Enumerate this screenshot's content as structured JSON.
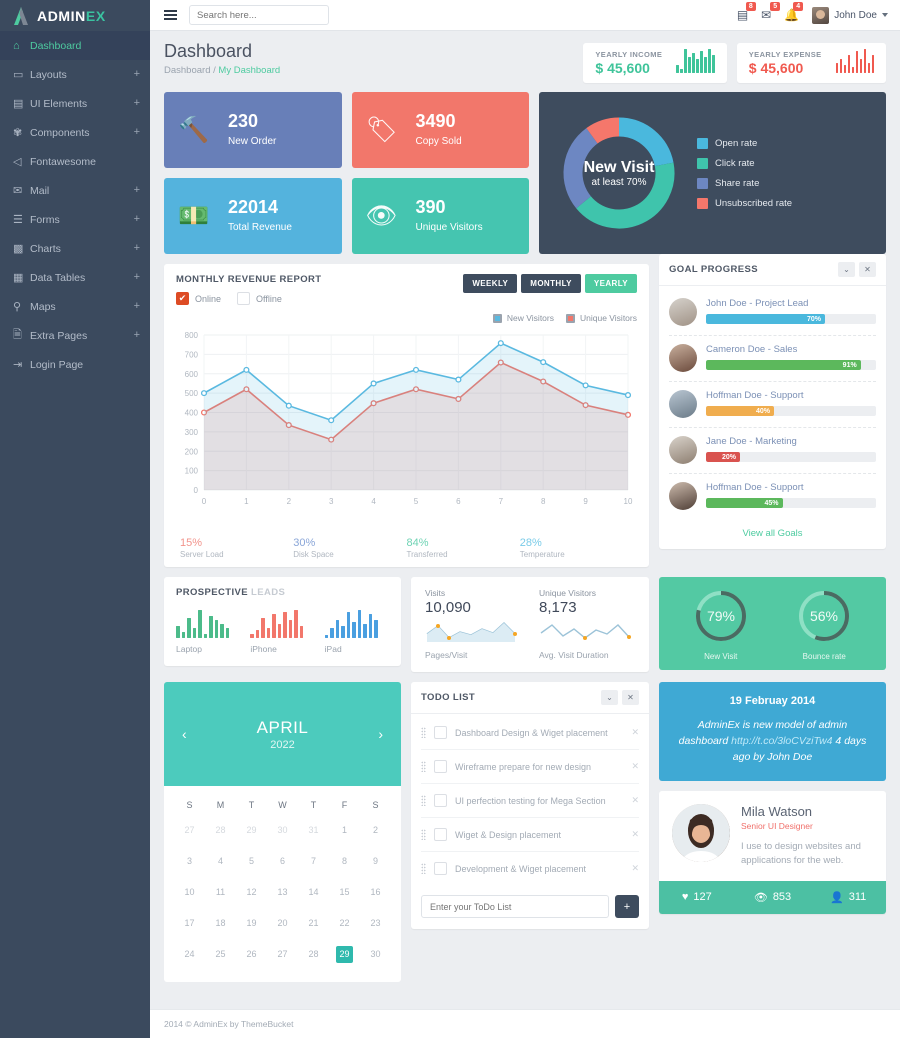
{
  "brand": {
    "name_main": "ADMIN",
    "name_accent": "EX",
    "logo_icon": "triangle-a-logo"
  },
  "sidebar": {
    "items": [
      {
        "label": "Dashboard",
        "icon": "home-icon",
        "expand": "",
        "active": true
      },
      {
        "label": "Layouts",
        "icon": "laptop-icon",
        "expand": "+",
        "active": false
      },
      {
        "label": "UI Elements",
        "icon": "book-icon",
        "expand": "+",
        "active": false
      },
      {
        "label": "Components",
        "icon": "gears-icon",
        "expand": "+",
        "active": false
      },
      {
        "label": "Fontawesome",
        "icon": "megaphone-icon",
        "expand": "",
        "active": false
      },
      {
        "label": "Mail",
        "icon": "envelope-icon",
        "expand": "+",
        "active": false
      },
      {
        "label": "Forms",
        "icon": "form-list-icon",
        "expand": "+",
        "active": false
      },
      {
        "label": "Charts",
        "icon": "bar-chart-icon",
        "expand": "+",
        "active": false
      },
      {
        "label": "Data Tables",
        "icon": "table-grid-icon",
        "expand": "+",
        "active": false
      },
      {
        "label": "Maps",
        "icon": "map-pin-icon",
        "expand": "+",
        "active": false
      },
      {
        "label": "Extra Pages",
        "icon": "file-icon",
        "expand": "+",
        "active": false
      },
      {
        "label": "Login Page",
        "icon": "sign-in-icon",
        "expand": "",
        "active": false
      }
    ]
  },
  "topbar": {
    "menu_toggle_icon": "hamburger-icon",
    "search": {
      "placeholder": "Search here...",
      "value": ""
    },
    "notifications": [
      {
        "icon": "tasks-icon",
        "count": "8"
      },
      {
        "icon": "envelope-icon",
        "count": "5"
      },
      {
        "icon": "bell-icon",
        "count": "4"
      }
    ],
    "user": {
      "name": "John Doe",
      "avatar": "user-avatar",
      "caret_icon": "caret-down-icon"
    }
  },
  "page": {
    "title": "Dashboard",
    "breadcrumb": {
      "root": "Dashboard",
      "sep": "/",
      "current": "My Dashboard"
    }
  },
  "mini_stats": [
    {
      "label": "YEARLY INCOME",
      "value": "$ 45,600",
      "color": "#3fc49a",
      "spark": [
        8,
        4,
        24,
        16,
        20,
        14,
        22,
        16,
        24,
        18
      ]
    },
    {
      "label": "YEARLY EXPENSE",
      "value": "$ 45,600",
      "color": "#f0594f",
      "spark": [
        10,
        14,
        8,
        18,
        6,
        22,
        14,
        24,
        10,
        18
      ]
    }
  ],
  "kpis": [
    {
      "number": "230",
      "caption": "New Order",
      "icon": "gavel-icon",
      "color": "#687fb8"
    },
    {
      "number": "3490",
      "caption": "Copy Sold",
      "icon": "tags-icon",
      "color": "#f2776b"
    },
    {
      "number": "22014",
      "caption": "Total Revenue",
      "icon": "money-icon",
      "color": "#54b3dd"
    },
    {
      "number": "390",
      "caption": "Unique Visitors",
      "icon": "eye-icon",
      "color": "#45c5b0"
    }
  ],
  "donut": {
    "center_title": "New Visit",
    "center_sub": "at least 70%",
    "background": "#3e4c5e",
    "legend": [
      {
        "label": "Open rate",
        "color": "#4ab8dd",
        "value": 22
      },
      {
        "label": "Click rate",
        "color": "#3fc4ac",
        "value": 42
      },
      {
        "label": "Share rate",
        "color": "#6d87c2",
        "value": 26
      },
      {
        "label": "Unsubscribed rate",
        "color": "#f5776b",
        "value": 10
      }
    ]
  },
  "revenue": {
    "title": "MONTHLY REVENUE REPORT",
    "checkboxes": [
      {
        "label": "Online",
        "checked": true
      },
      {
        "label": "Offline",
        "checked": false
      }
    ],
    "range_buttons": [
      {
        "label": "WEEKLY",
        "active": false
      },
      {
        "label": "MONTHLY",
        "active": false
      },
      {
        "label": "YEARLY",
        "active": true
      }
    ],
    "stats": [
      {
        "percent": "15%",
        "caption": "Server Load",
        "color": "#f2948c"
      },
      {
        "percent": "30%",
        "caption": "Disk Space",
        "color": "#8aa6d8"
      },
      {
        "percent": "84%",
        "caption": "Transferred",
        "color": "#6fd3b4"
      },
      {
        "percent": "28%",
        "caption": "Temperature",
        "color": "#79cbe8"
      }
    ]
  },
  "chart_data": {
    "type": "area",
    "title": "MONTHLY REVENUE REPORT",
    "xlabel": "",
    "ylabel": "",
    "x": [
      0,
      1,
      2,
      3,
      4,
      5,
      6,
      7,
      8,
      9,
      10
    ],
    "xticks": [
      "0",
      "1",
      "2",
      "3",
      "4",
      "5",
      "6",
      "7",
      "8",
      "9",
      "10"
    ],
    "yticks": [
      "0",
      "100",
      "200",
      "300",
      "400",
      "500",
      "600",
      "700",
      "800"
    ],
    "xlim": [
      0,
      10
    ],
    "ylim": [
      0,
      800
    ],
    "grid": true,
    "legend_position": "top-right",
    "series": [
      {
        "name": "New Visitors",
        "color": "#5ab9e0",
        "values": [
          500,
          620,
          435,
          360,
          550,
          620,
          570,
          758,
          660,
          540,
          490
        ]
      },
      {
        "name": "Unique Visitors",
        "color": "#f2776b",
        "values": [
          400,
          520,
          335,
          260,
          448,
          520,
          470,
          658,
          560,
          438,
          388
        ]
      }
    ]
  },
  "goal_progress": {
    "title": "GOAL PROGRESS",
    "tools": [
      {
        "icon": "chevron-down-icon"
      },
      {
        "icon": "close-icon"
      }
    ],
    "items": [
      {
        "name": "John Doe - Project Lead",
        "percent": "70%",
        "value": 70,
        "color": "#4ab8dd",
        "avatar": "avatar-john"
      },
      {
        "name": "Cameron Doe - Sales",
        "percent": "91%",
        "value": 91,
        "color": "#5cb85c",
        "avatar": "avatar-cameron"
      },
      {
        "name": "Hoffman Doe - Support",
        "percent": "40%",
        "value": 40,
        "color": "#f0ad4e",
        "avatar": "avatar-hoffman"
      },
      {
        "name": "Jane Doe - Marketing",
        "percent": "20%",
        "value": 20,
        "color": "#d9534f",
        "avatar": "avatar-jane"
      },
      {
        "name": "Hoffman Doe - Support",
        "percent": "45%",
        "value": 45,
        "color": "#5cb85c",
        "avatar": "avatar-hoffman2"
      }
    ],
    "view_all": "View all Goals"
  },
  "prospective": {
    "title_strong": "PROSPECTIVE",
    "title_muted": "LEADS",
    "items": [
      {
        "label": "Laptop",
        "color": "#4cbb8a",
        "bars": [
          12,
          6,
          20,
          10,
          28,
          4,
          22,
          18,
          14,
          10
        ]
      },
      {
        "label": "iPhone",
        "color": "#f2776b",
        "bars": [
          4,
          8,
          20,
          10,
          24,
          14,
          26,
          18,
          28,
          12
        ]
      },
      {
        "label": "iPad",
        "color": "#4a9fe0",
        "bars": [
          3,
          10,
          18,
          12,
          26,
          16,
          28,
          14,
          24,
          18
        ]
      }
    ]
  },
  "visits": {
    "columns": [
      {
        "label": "Visits",
        "value": "10,090",
        "caption": "Pages/Visit"
      },
      {
        "label": "Unique Visitors",
        "value": "8,173",
        "caption": "Avg. Visit Duration"
      }
    ]
  },
  "gauges": {
    "background": "#53c9a3",
    "items": [
      {
        "percent": "79%",
        "value": 79,
        "caption": "New Visit"
      },
      {
        "percent": "56%",
        "value": 56,
        "caption": "Bounce rate"
      }
    ]
  },
  "tweet": {
    "date": "19 Februay 2014",
    "text_before": "AdminEx is new model of admin dashboard ",
    "link": "http://t.co/3loCVziTw4",
    "text_after": " 4 days ago by John Doe",
    "background": "#3fa9d4"
  },
  "profile": {
    "name": "Mila Watson",
    "role": "Senior UI Designer",
    "description": "I use to design websites and applications for the web.",
    "avatar": "avatar-mila",
    "stats": [
      {
        "icon": "heart-icon",
        "value": "127"
      },
      {
        "icon": "eye-icon",
        "value": "853"
      },
      {
        "icon": "user-icon",
        "value": "311"
      }
    ]
  },
  "calendar": {
    "month": "APRIL",
    "year": "2022",
    "prev_icon": "chevron-left-icon",
    "next_icon": "chevron-right-icon",
    "weekdays": [
      "S",
      "M",
      "T",
      "W",
      "T",
      "F",
      "S"
    ],
    "weeks": [
      [
        {
          "d": "27",
          "mut": true
        },
        {
          "d": "28",
          "mut": true
        },
        {
          "d": "29",
          "mut": true
        },
        {
          "d": "30",
          "mut": true
        },
        {
          "d": "31",
          "mut": true
        },
        {
          "d": "1"
        },
        {
          "d": "2"
        }
      ],
      [
        {
          "d": "3"
        },
        {
          "d": "4"
        },
        {
          "d": "5"
        },
        {
          "d": "6"
        },
        {
          "d": "7"
        },
        {
          "d": "8"
        },
        {
          "d": "9"
        }
      ],
      [
        {
          "d": "10"
        },
        {
          "d": "11"
        },
        {
          "d": "12"
        },
        {
          "d": "13"
        },
        {
          "d": "14"
        },
        {
          "d": "15"
        },
        {
          "d": "16"
        }
      ],
      [
        {
          "d": "17"
        },
        {
          "d": "18"
        },
        {
          "d": "19"
        },
        {
          "d": "20"
        },
        {
          "d": "21"
        },
        {
          "d": "22"
        },
        {
          "d": "23"
        }
      ],
      [
        {
          "d": "24"
        },
        {
          "d": "25"
        },
        {
          "d": "26"
        },
        {
          "d": "27"
        },
        {
          "d": "28"
        },
        {
          "d": "29",
          "sel": true
        },
        {
          "d": "30"
        }
      ]
    ]
  },
  "todo": {
    "title": "TODO LIST",
    "tools": [
      {
        "icon": "chevron-down-icon"
      },
      {
        "icon": "close-icon"
      }
    ],
    "items": [
      {
        "text": "Dashboard Design & Wiget placement",
        "checked": false
      },
      {
        "text": "Wireframe prepare for new design",
        "checked": false
      },
      {
        "text": "UI perfection testing for Mega Section",
        "checked": false
      },
      {
        "text": "Wiget & Design placement",
        "checked": false
      },
      {
        "text": "Development & Wiget placement",
        "checked": false
      }
    ],
    "input_placeholder": "Enter your ToDo List",
    "add_button": "+"
  },
  "footer": {
    "text": "2014 © AdminEx by ThemeBucket"
  }
}
